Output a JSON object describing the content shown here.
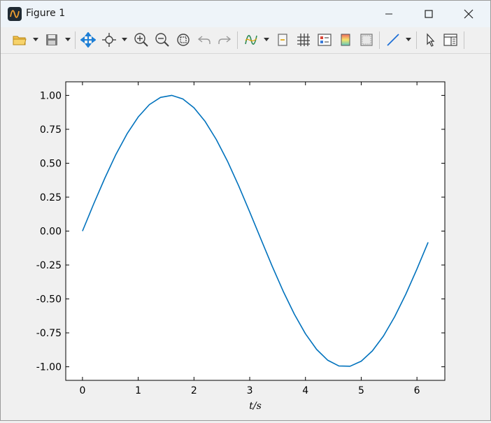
{
  "window": {
    "title": "Figure 1",
    "controls": [
      "minimize-icon",
      "maximize-icon",
      "close-icon"
    ]
  },
  "toolbar": {
    "items": [
      "open-folder-icon",
      "save-icon",
      "pan-icon",
      "data-cursor-icon",
      "zoom-in-icon",
      "zoom-out-icon",
      "zoom-fit-icon",
      "undo-icon",
      "redo-icon",
      "curve-icon",
      "legend-icon",
      "grid-icon",
      "legend-box-icon",
      "colormap-icon",
      "axes-box-icon",
      "line-style-icon",
      "select-pointer-icon",
      "property-panel-icon"
    ]
  },
  "colors": {
    "line": "#0072bd",
    "axes": "#000000",
    "background": "#ffffff",
    "figure": "#f0f0f0"
  },
  "chart_data": {
    "type": "line",
    "title": "",
    "xlabel": "t/s",
    "ylabel": "",
    "xlim": [
      -0.3,
      6.5
    ],
    "ylim": [
      -1.1,
      1.1
    ],
    "xticks": [
      0,
      1,
      2,
      3,
      4,
      5,
      6
    ],
    "yticks": [
      -1.0,
      -0.75,
      -0.5,
      -0.25,
      0.0,
      0.25,
      0.5,
      0.75,
      1.0
    ],
    "ytick_labels": [
      "-1.00",
      "-0.75",
      "-0.50",
      "-0.25",
      "0.00",
      "0.25",
      "0.50",
      "0.75",
      "1.00"
    ],
    "grid": false,
    "series": [
      {
        "x": [
          0,
          0.2,
          0.4,
          0.6,
          0.8,
          1.0,
          1.2,
          1.4,
          1.6,
          1.8,
          2.0,
          2.2,
          2.4,
          2.6,
          2.8,
          3.0,
          3.2,
          3.4,
          3.6,
          3.8,
          4.0,
          4.2,
          4.4,
          4.6,
          4.8,
          5.0,
          5.2,
          5.4,
          5.6,
          5.8,
          6.0,
          6.2
        ],
        "values": [
          0,
          0.199,
          0.389,
          0.565,
          0.717,
          0.841,
          0.932,
          0.985,
          1.0,
          0.974,
          0.909,
          0.808,
          0.675,
          0.516,
          0.335,
          0.141,
          -0.058,
          -0.256,
          -0.443,
          -0.612,
          -0.757,
          -0.872,
          -0.952,
          -0.994,
          -0.996,
          -0.959,
          -0.883,
          -0.773,
          -0.631,
          -0.465,
          -0.279,
          -0.083
        ]
      }
    ]
  }
}
